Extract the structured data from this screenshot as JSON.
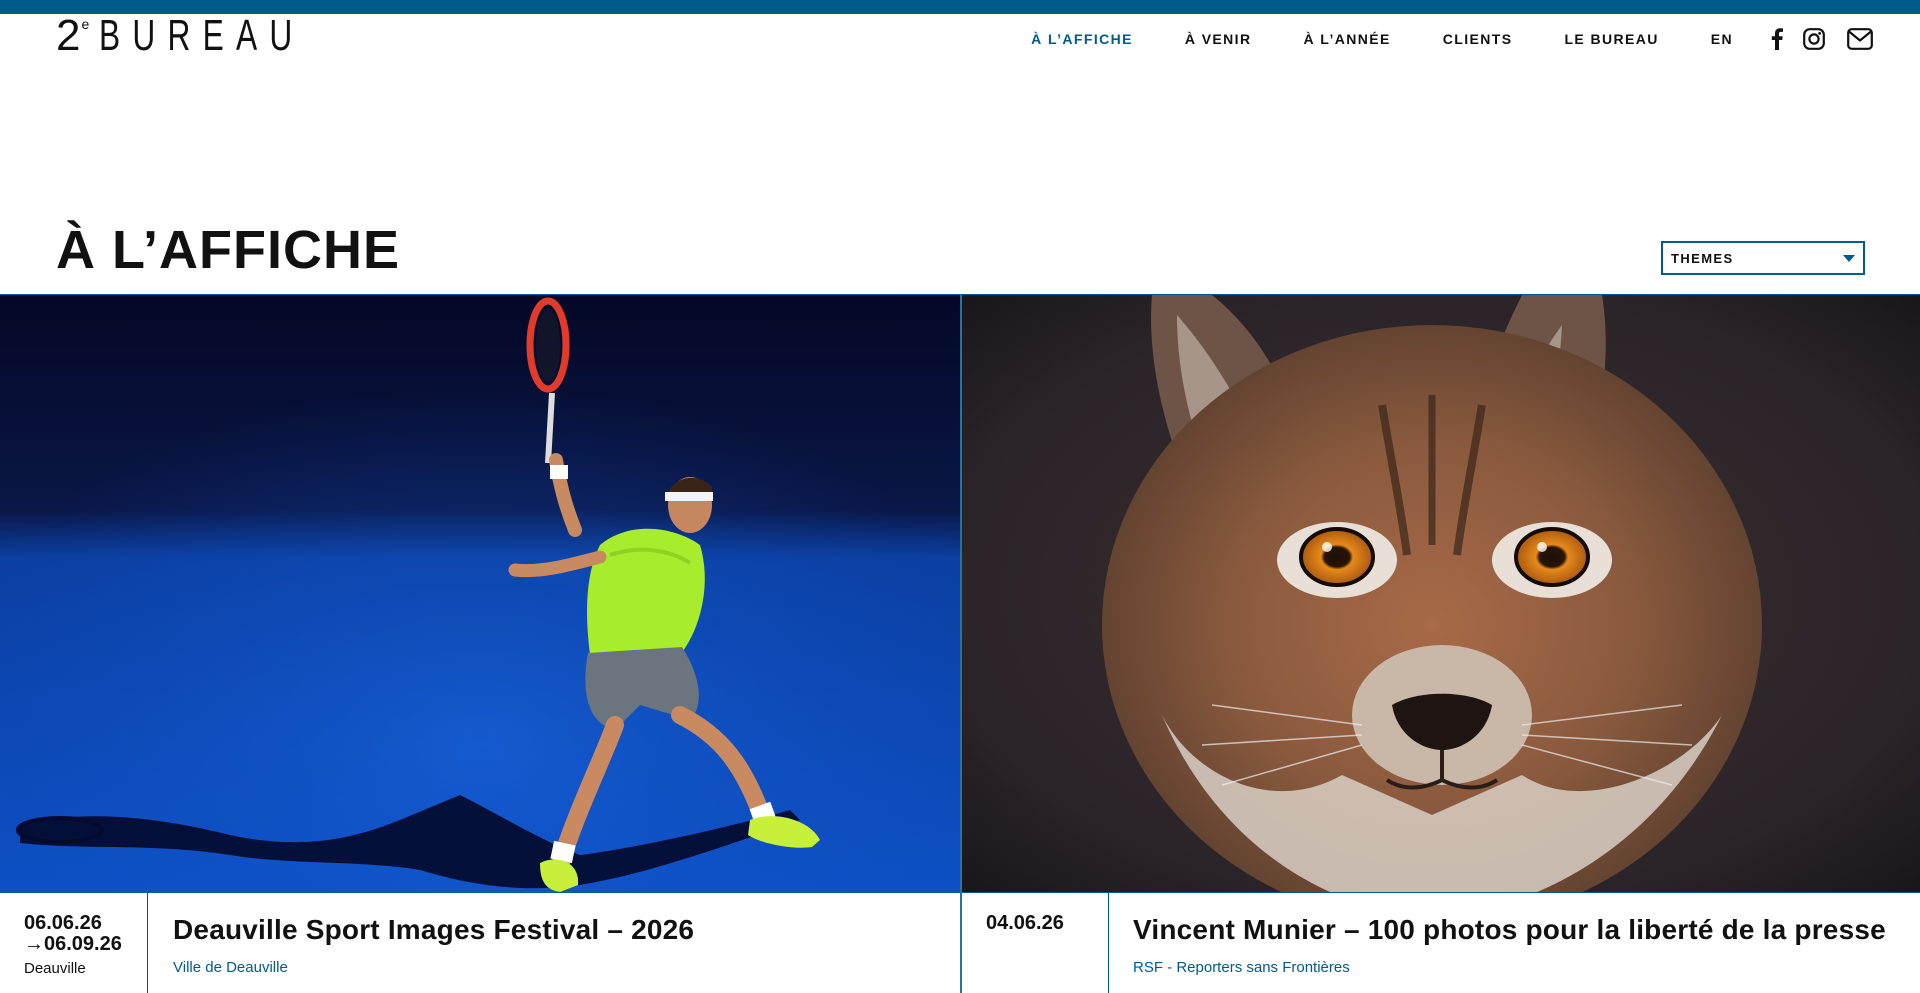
{
  "brand": {
    "logo_number": "2",
    "logo_superscript": "e",
    "logo_word": "BUREAU",
    "accent_color": "#005a8c"
  },
  "nav": {
    "items": [
      {
        "label": "À L’AFFICHE",
        "active": true
      },
      {
        "label": "À VENIR",
        "active": false
      },
      {
        "label": "À L’ANNÉE",
        "active": false
      },
      {
        "label": "CLIENTS",
        "active": false
      },
      {
        "label": "LE BUREAU",
        "active": false
      }
    ],
    "language": "EN",
    "icons": [
      "facebook-icon",
      "instagram-icon",
      "mail-icon"
    ]
  },
  "page": {
    "title": "À L’AFFICHE",
    "filter_label": "THEMES"
  },
  "cards": [
    {
      "image": "tennis-player-photo",
      "date_line1": "06.06.26",
      "date_line2": "→06.09.26",
      "place": "Deauville",
      "title": "Deauville Sport Images Festival – 2026",
      "client": "Ville de Deauville"
    },
    {
      "image": "lynx-portrait-photo",
      "date_line1": "04.06.26",
      "title": "Vincent Munier – 100 photos pour la liberté de la presse",
      "client": "RSF - Reporters sans Frontières"
    }
  ]
}
